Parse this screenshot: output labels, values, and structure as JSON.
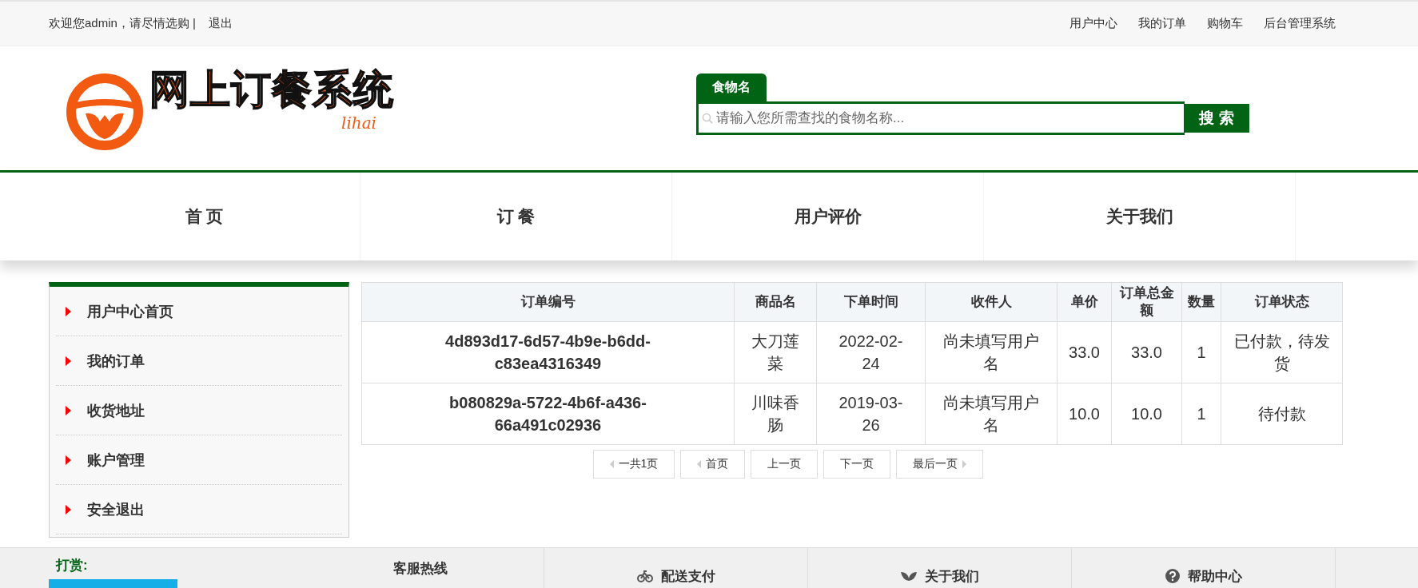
{
  "top_bar": {
    "welcome": "欢迎您admin，请尽情选购 |",
    "logout": "退出",
    "links": [
      "用户中心",
      "我的订单",
      "购物车",
      "后台管理系统"
    ]
  },
  "logo": {
    "title": "网上订餐系统",
    "signature": "lihai"
  },
  "search": {
    "tab": "食物名",
    "placeholder": "请输入您所需查找的食物名称...",
    "button": "搜 索"
  },
  "nav": [
    {
      "label": "首 页"
    },
    {
      "label": "订 餐"
    },
    {
      "label": "用户评价"
    },
    {
      "label": "关于我们"
    }
  ],
  "sidebar": {
    "items": [
      "用户中心首页",
      "我的订单",
      "收货地址",
      "账户管理",
      "安全退出"
    ]
  },
  "table": {
    "columns": [
      "订单编号",
      "商品名",
      "下单时间",
      "收件人",
      "单价",
      "订单总金额",
      "数量",
      "订单状态"
    ],
    "rows": [
      [
        "4d893d17-6d57-4b9e-b6dd-c83ea4316349",
        "大刀莲菜",
        "2022-02-24",
        "尚未填写用户名",
        "33.0",
        "33.0",
        "1",
        "已付款，待发货"
      ],
      [
        "b080829a-5722-4b6f-a436-66a491c02936",
        "川味香肠",
        "2019-03-26",
        "尚未填写用户名",
        "10.0",
        "10.0",
        "1",
        "待付款"
      ]
    ]
  },
  "pagination": [
    {
      "label": "一共1页",
      "kind": "left"
    },
    {
      "label": "首页",
      "kind": "left"
    },
    {
      "label": "上一页",
      "kind": "plain"
    },
    {
      "label": "下一页",
      "kind": "plain"
    },
    {
      "label": "最后一页",
      "kind": "right"
    }
  ],
  "footer": {
    "reward": "打赏:",
    "columns": [
      {
        "label": "客服热线",
        "kind": "plain"
      },
      {
        "label": "配送支付",
        "kind": "bike"
      },
      {
        "label": "关于我们",
        "kind": "leaf"
      },
      {
        "label": "帮助中心",
        "kind": "help"
      }
    ]
  }
}
